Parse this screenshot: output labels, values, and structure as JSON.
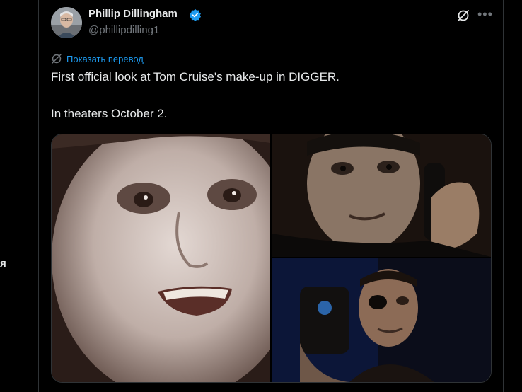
{
  "left_edge": {
    "text": "я"
  },
  "tweet": {
    "author": {
      "name": "Phillip Dillingham",
      "handle": "@phillipdilling1",
      "verified": true,
      "avatar_icon": "profile-photo-icon"
    },
    "translate_label": "Показать перевод",
    "text_lines": [
      "First official look at Tom Cruise's make-up in DIGGER.",
      "In theaters October 2."
    ],
    "media": [
      {
        "name": "pale-face-closeup-photo"
      },
      {
        "name": "man-on-phone-photo"
      },
      {
        "name": "man-with-eyepatch-photo"
      }
    ]
  },
  "colors": {
    "background": "#000000",
    "text": "#e7e9ea",
    "muted": "#71767b",
    "accent": "#1d9bf0",
    "border": "#2f3336"
  },
  "icons": {
    "verified": "verified-badge-icon",
    "grok": "grok-icon",
    "more": "more-icon",
    "translate": "translate-icon"
  }
}
